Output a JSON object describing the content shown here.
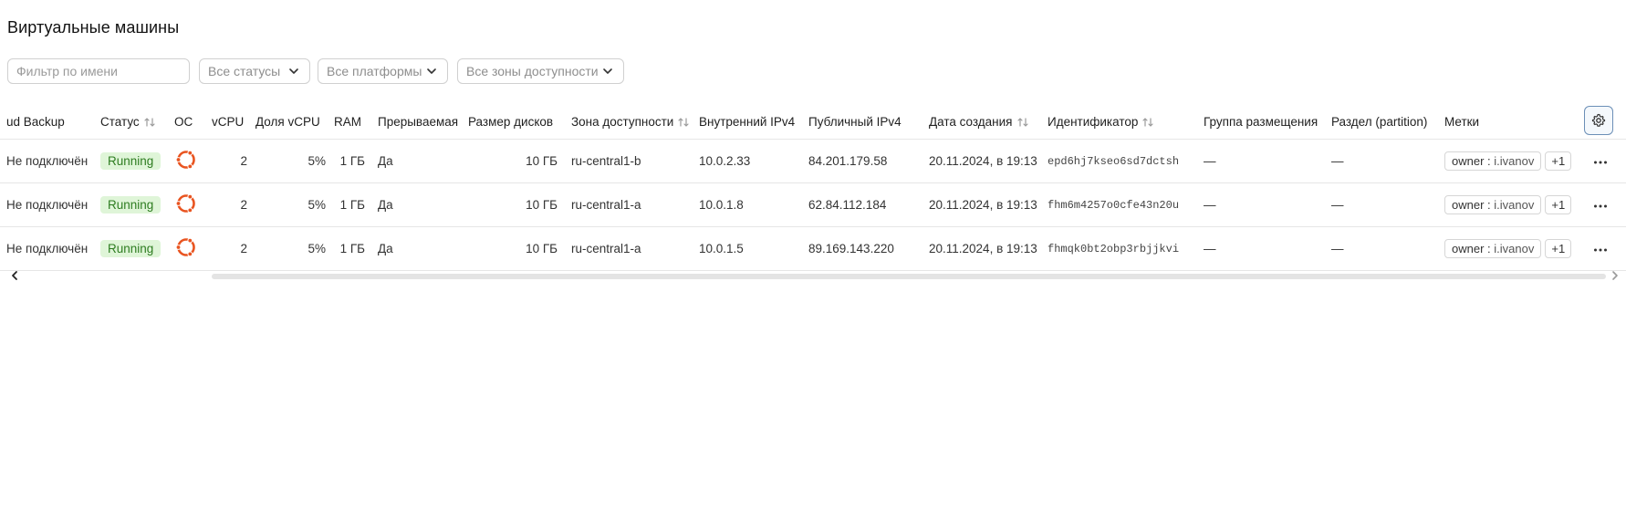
{
  "page": {
    "title": "Виртуальные машины"
  },
  "filters": {
    "name_placeholder": "Фильтр по имени",
    "status_select": "Все статусы",
    "platform_select": "Все платформы",
    "zone_select": "Все зоны доступности"
  },
  "table": {
    "columns": {
      "backup": "ud Backup",
      "status": "Статус",
      "os": "ОС",
      "vcpu": "vCPU",
      "vcpu_share": "Доля vCPU",
      "ram": "RAM",
      "preemptible": "Прерываемая",
      "disk_size": "Размер дисков",
      "zone": "Зона доступности",
      "internal_ip": "Внутренний IPv4",
      "public_ip": "Публичный IPv4",
      "created": "Дата создания",
      "id": "Идентификатор",
      "placement_group": "Группа размещения",
      "partition": "Раздел (partition)",
      "labels": "Метки"
    },
    "rows": [
      {
        "backup": "Не подключён",
        "status": "Running",
        "os_icon": "ubuntu-icon",
        "vcpu": "2",
        "vcpu_share": "5%",
        "ram": "1 ГБ",
        "preemptible": "Да",
        "disk_size": "10 ГБ",
        "zone": "ru-central1-b",
        "internal_ip": "10.0.2.33",
        "public_ip": "84.201.179.58",
        "created": "20.11.2024, в 19:13",
        "id": "epd6hj7kseo6sd7dctsh",
        "placement_group": "—",
        "partition": "—",
        "label_key": "owner",
        "label_sep": ":",
        "label_value": "i.ivanov",
        "label_more": "+1"
      },
      {
        "backup": "Не подключён",
        "status": "Running",
        "os_icon": "ubuntu-icon",
        "vcpu": "2",
        "vcpu_share": "5%",
        "ram": "1 ГБ",
        "preemptible": "Да",
        "disk_size": "10 ГБ",
        "zone": "ru-central1-a",
        "internal_ip": "10.0.1.8",
        "public_ip": "62.84.112.184",
        "created": "20.11.2024, в 19:13",
        "id": "fhm6m4257o0cfe43n20u",
        "placement_group": "—",
        "partition": "—",
        "label_key": "owner",
        "label_sep": ":",
        "label_value": "i.ivanov",
        "label_more": "+1"
      },
      {
        "backup": "Не подключён",
        "status": "Running",
        "os_icon": "ubuntu-icon",
        "vcpu": "2",
        "vcpu_share": "5%",
        "ram": "1 ГБ",
        "preemptible": "Да",
        "disk_size": "10 ГБ",
        "zone": "ru-central1-a",
        "internal_ip": "10.0.1.5",
        "public_ip": "89.169.143.220",
        "created": "20.11.2024, в 19:13",
        "id": "fhmqk0bt2obp3rbjjkvi",
        "placement_group": "—",
        "partition": "—",
        "label_key": "owner",
        "label_sep": ":",
        "label_value": "i.ivanov",
        "label_more": "+1"
      }
    ]
  },
  "colors": {
    "status_bg": "#dff5d8",
    "status_text": "#2e7d21",
    "ubuntu_orange": "#e95420",
    "settings_border": "#6b8fb7"
  },
  "icons": {
    "settings": "gear-icon",
    "more": "ellipsis-icon",
    "sort": "sort-arrows-icon",
    "scroll_left": "chevron-left-icon",
    "scroll_right": "chevron-right-icon",
    "dropdown": "chevron-down-icon"
  }
}
